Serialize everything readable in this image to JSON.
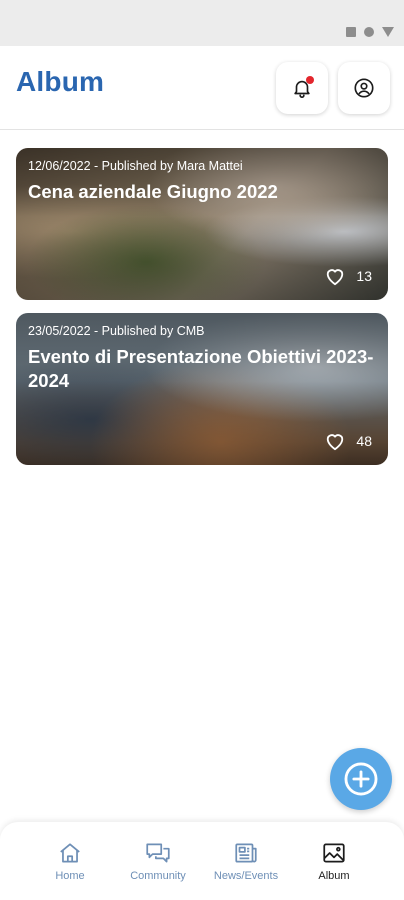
{
  "status_bar": {
    "icons": [
      "square-icon",
      "circle-icon",
      "triangle-icon"
    ]
  },
  "header": {
    "title": "Album",
    "notification_button": "bell-icon",
    "profile_button": "user-icon"
  },
  "albums": [
    {
      "meta": "12/06/2022 - Published by Mara Mattei",
      "title": "Cena aziendale Giugno 2022",
      "likes": "13"
    },
    {
      "meta": "23/05/2022 - Published by CMB",
      "title": "Evento di Presentazione Obiettivi 2023-2024",
      "likes": "48"
    }
  ],
  "fab": {
    "icon": "plus-circle-icon"
  },
  "bottom_nav": {
    "items": [
      {
        "label": "Home",
        "icon": "home-icon"
      },
      {
        "label": "Community",
        "icon": "chat-icon"
      },
      {
        "label": "News/Events",
        "icon": "news-icon"
      },
      {
        "label": "Album",
        "icon": "image-icon"
      }
    ],
    "active": "Album"
  },
  "colors": {
    "brand": "#2a66b0",
    "fab": "#5aa8e6",
    "nav_inactive": "#6e8fb6",
    "notification": "#e3262d"
  }
}
